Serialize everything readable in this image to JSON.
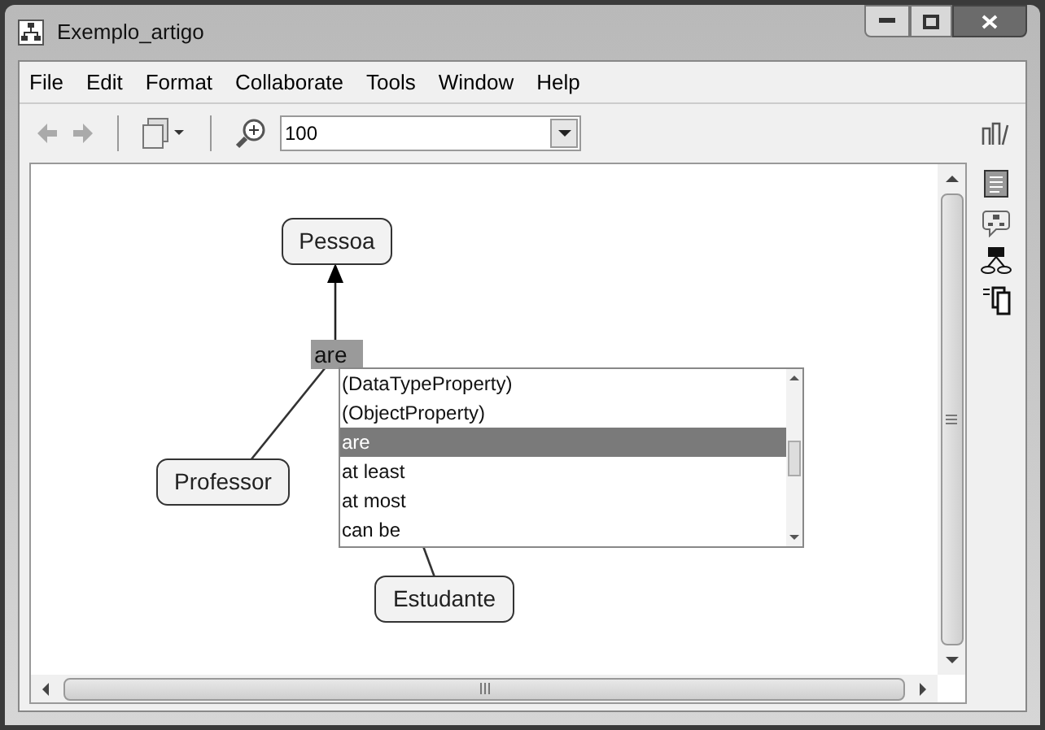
{
  "window": {
    "title": "Exemplo_artigo"
  },
  "menu": [
    "File",
    "Edit",
    "Format",
    "Collaborate",
    "Tools",
    "Window",
    "Help"
  ],
  "toolbar": {
    "zoom": "100"
  },
  "concepts": [
    {
      "label": "Pessoa"
    },
    {
      "label": "Professor"
    },
    {
      "label": "Estudante"
    }
  ],
  "linking_phrase": {
    "text": "are"
  },
  "suggestions": [
    {
      "label": "(DataTypeProperty)",
      "selected": false
    },
    {
      "label": "(ObjectProperty)",
      "selected": false
    },
    {
      "label": "are",
      "selected": true
    },
    {
      "label": "at least",
      "selected": false
    },
    {
      "label": "at most",
      "selected": false
    },
    {
      "label": "can be",
      "selected": false
    }
  ]
}
